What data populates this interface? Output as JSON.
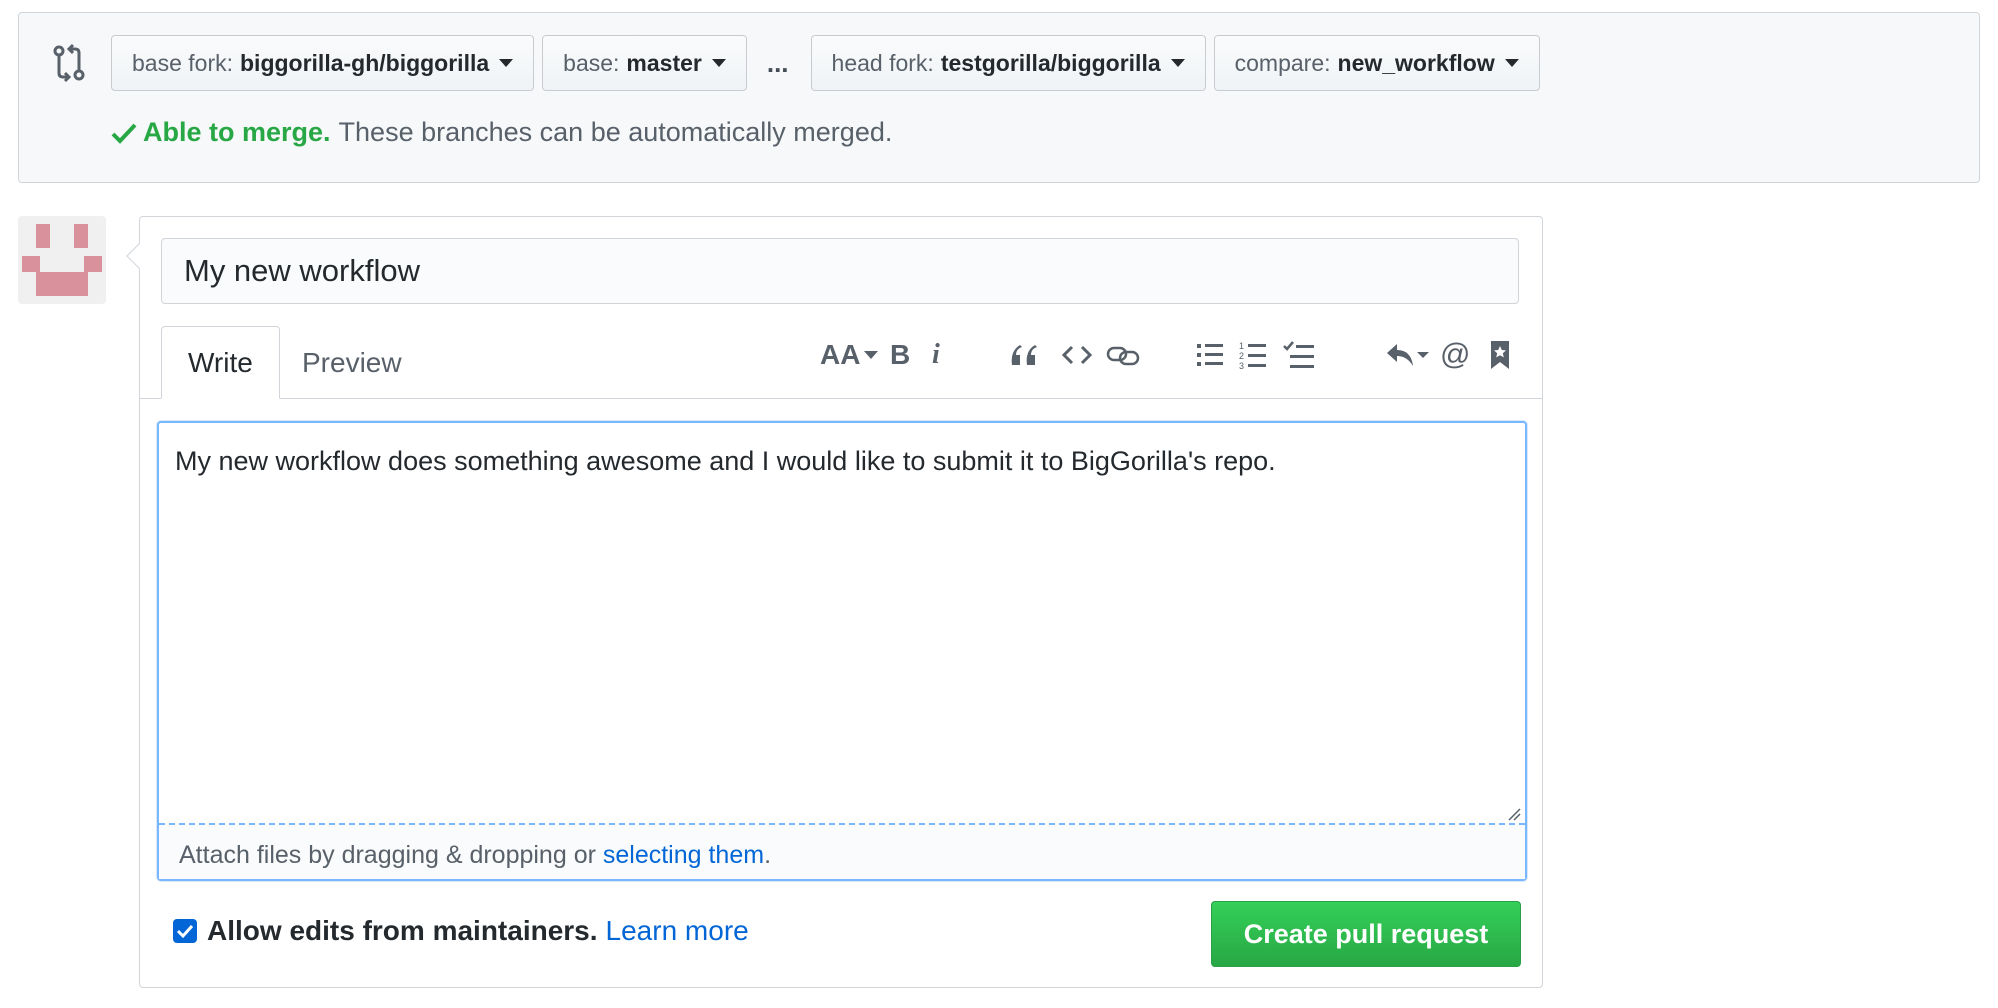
{
  "compare": {
    "icon": "compare-arrows-icon",
    "base_fork": {
      "label": "base fork:",
      "value": "biggorilla-gh/biggorilla"
    },
    "base": {
      "label": "base:",
      "value": "master"
    },
    "separator": "...",
    "head_fork": {
      "label": "head fork:",
      "value": "testgorilla/biggorilla"
    },
    "compare_branch": {
      "label": "compare:",
      "value": "new_workflow"
    },
    "merge_ok": "Able to merge.",
    "merge_desc": "These branches can be automatically merged."
  },
  "form": {
    "title_value": "My new workflow",
    "tabs": {
      "write": "Write",
      "preview": "Preview"
    },
    "toolbar": {
      "header": "AA",
      "bold": "B",
      "italic": "i",
      "icons": [
        "header-icon",
        "bold-icon",
        "italic-icon",
        "quote-icon",
        "code-icon",
        "link-icon",
        "unordered-list-icon",
        "ordered-list-icon",
        "task-list-icon",
        "reply-icon",
        "mention-icon",
        "bookmark-icon"
      ]
    },
    "body_value": "My new workflow does something awesome and I would like to submit it to BigGorilla's repo.",
    "attach_text": "Attach files by dragging & dropping or ",
    "attach_link": "selecting them",
    "attach_end": ".",
    "maintainers_label": "Allow edits from maintainers.",
    "maintainers_checked": true,
    "learn_more": "Learn more",
    "create_button": "Create pull request"
  },
  "colors": {
    "success": "#28a745",
    "link": "#0366d6",
    "avatar": "#d9919b"
  }
}
